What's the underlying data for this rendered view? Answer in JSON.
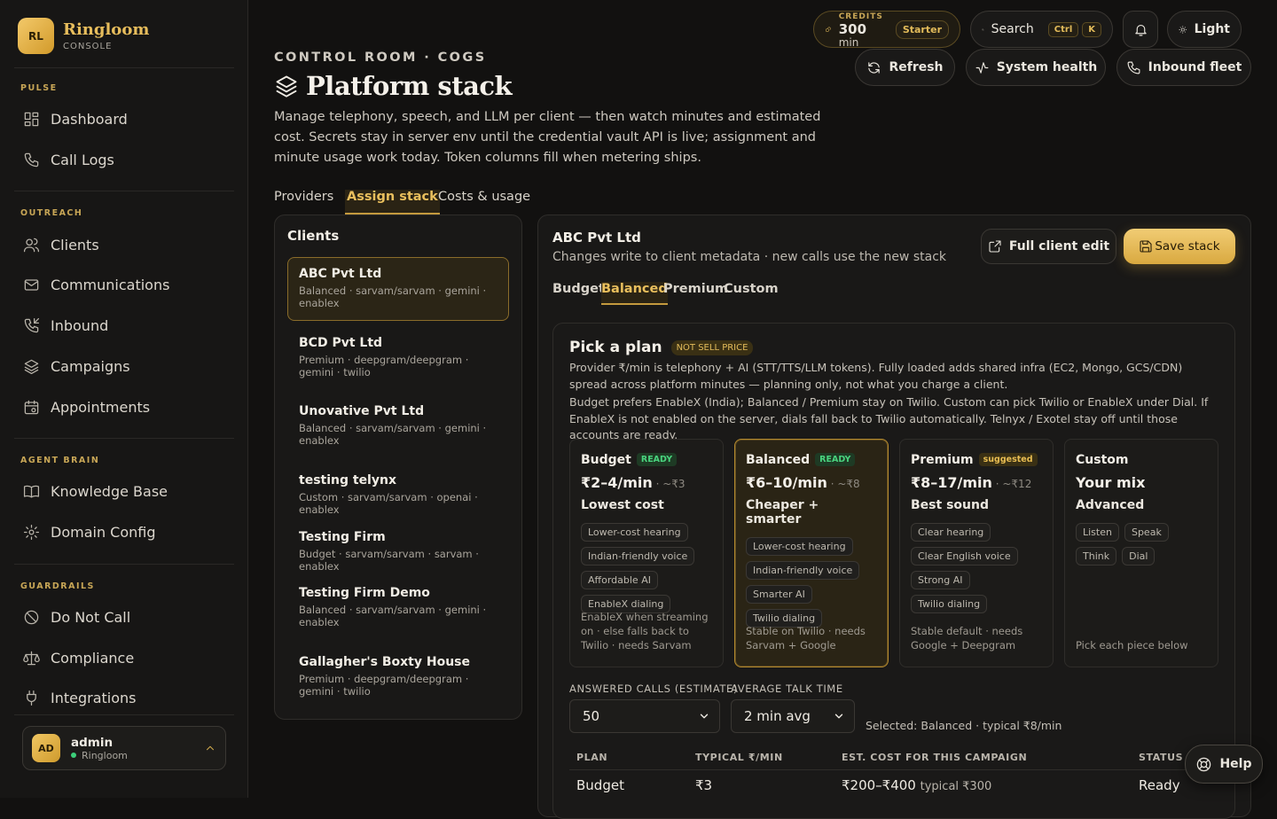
{
  "brand": {
    "logo": "RL",
    "name": "Ringloom",
    "sub": "CONSOLE"
  },
  "sidebar": {
    "sections": [
      {
        "label": "PULSE"
      },
      {
        "label": "OUTREACH"
      },
      {
        "label": "AGENT BRAIN"
      },
      {
        "label": "GUARDRAILS"
      }
    ],
    "items": [
      {
        "label": "Dashboard",
        "icon": "grid-icon"
      },
      {
        "label": "Call Logs",
        "icon": "phone-icon"
      },
      {
        "label": "Clients",
        "icon": "users-icon"
      },
      {
        "label": "Communications",
        "icon": "mail-icon"
      },
      {
        "label": "Inbound",
        "icon": "phone-incoming-icon"
      },
      {
        "label": "Campaigns",
        "icon": "layers-icon"
      },
      {
        "label": "Appointments",
        "icon": "calendar-icon"
      },
      {
        "label": "Knowledge Base",
        "icon": "book-icon"
      },
      {
        "label": "Domain Config",
        "icon": "gear-icon"
      },
      {
        "label": "Do Not Call",
        "icon": "ban-icon"
      },
      {
        "label": "Compliance",
        "icon": "scale-icon"
      },
      {
        "label": "Integrations",
        "icon": "plug-icon"
      }
    ]
  },
  "user": {
    "initials": "AD",
    "name": "admin",
    "org": "Ringloom"
  },
  "topbar": {
    "credits_label": "CREDITS",
    "credits_value": "300",
    "credits_unit": "min",
    "plan": "Starter",
    "search": "Search",
    "kbd1": "Ctrl",
    "kbd2": "K",
    "theme": "Light",
    "refresh": "Refresh",
    "system_health": "System health",
    "inbound_fleet": "Inbound fleet"
  },
  "header": {
    "eyebrow": "CONTROL ROOM · COGS",
    "title": "Platform stack",
    "description": "Manage telephony, speech, and LLM per client — then watch minutes and estimated cost. Secrets stay in server env until the credential vault API is live; assignment and minute usage work today. Token columns fill when metering ships."
  },
  "tabs": [
    "Providers",
    "Assign stack",
    "Costs & usage"
  ],
  "clients": {
    "title": "Clients",
    "list": [
      {
        "name": "ABC Pvt Ltd",
        "meta": "Balanced · sarvam/sarvam · gemini · enablex"
      },
      {
        "name": "BCD Pvt Ltd",
        "meta": "Premium · deepgram/deepgram · gemini · twilio"
      },
      {
        "name": "Unovative Pvt Ltd",
        "meta": "Balanced · sarvam/sarvam · gemini · enablex"
      },
      {
        "name": "testing telynx",
        "meta": "Custom · sarvam/sarvam · openai · enablex"
      },
      {
        "name": "Testing Firm",
        "meta": "Budget · sarvam/sarvam · sarvam · enablex"
      },
      {
        "name": "Testing Firm Demo",
        "meta": "Balanced · sarvam/sarvam · gemini · enablex"
      },
      {
        "name": "Gallagher's Boxty House",
        "meta": "Premium · deepgram/deepgram · gemini · twilio"
      }
    ]
  },
  "detail": {
    "client": "ABC Pvt Ltd",
    "subtitle": "Changes write to client metadata · new calls use the new stack",
    "full_edit": "Full client edit",
    "save": "Save stack",
    "plan_tabs": [
      "Budget",
      "Balanced",
      "Premium",
      "Custom"
    ]
  },
  "pick": {
    "title": "Pick a plan",
    "badge": "NOT SELL PRICE",
    "p1": "Provider ₹/min is telephony + AI (STT/TTS/LLM tokens). Fully loaded adds shared infra (EC2, Mongo, GCS/CDN) spread across platform minutes — planning only, not what you charge a client.",
    "p2": "Budget prefers EnableX (India); Balanced / Premium stay on Twilio. Custom can pick Twilio or EnableX under Dial. If EnableX is not enabled on the server, dials fall back to Twilio automatically. Telnyx / Exotel stay off until those accounts are ready."
  },
  "plans": [
    {
      "name": "Budget",
      "badge": "READY",
      "price": "₹2–4/min",
      "typical": " · ~₹3",
      "tagline": "Lowest cost",
      "chips": [
        "Lower-cost hearing",
        "Indian-friendly voice",
        "Affordable AI",
        "EnableX dialing"
      ],
      "note": "EnableX when streaming on · else falls back to Twilio · needs Sarvam"
    },
    {
      "name": "Balanced",
      "badge": "READY",
      "price": "₹6–10/min",
      "typical": " · ~₹8",
      "tagline": "Cheaper + smarter",
      "chips": [
        "Lower-cost hearing",
        "Indian-friendly voice",
        "Smarter AI",
        "Twilio dialing"
      ],
      "note": "Stable on Twilio · needs Sarvam + Google"
    },
    {
      "name": "Premium",
      "badge": "suggested",
      "price": "₹8–17/min",
      "typical": " · ~₹12",
      "tagline": "Best sound",
      "chips": [
        "Clear hearing",
        "Clear English voice",
        "Strong AI",
        "Twilio dialing"
      ],
      "note": "Stable default · needs Google + Deepgram"
    },
    {
      "name": "Custom",
      "badge": "",
      "price": "Your mix",
      "typical": "",
      "tagline": "Advanced",
      "chips": [
        "Listen",
        "Speak",
        "Think",
        "Dial"
      ],
      "note": "Pick each piece below"
    }
  ],
  "estimate": {
    "calls_label": "ANSWERED CALLS (ESTIMATE)",
    "calls_value": "50",
    "talk_label": "AVERAGE TALK TIME",
    "talk_value": "2 min avg",
    "selected": "Selected: Balanced · typical ₹8/min"
  },
  "table": {
    "headers": [
      "PLAN",
      "TYPICAL ₹/MIN",
      "EST. COST FOR THIS CAMPAIGN",
      "STATUS"
    ],
    "row": {
      "plan": "Budget",
      "typical": "₹3",
      "cost": "₹200–₹400",
      "cost_typ": "typical ₹300",
      "status": "Ready"
    }
  },
  "help": "Help",
  "colors": {
    "accent": "#e7bd5c",
    "ready": "#49d37e",
    "bg": "#121110"
  }
}
